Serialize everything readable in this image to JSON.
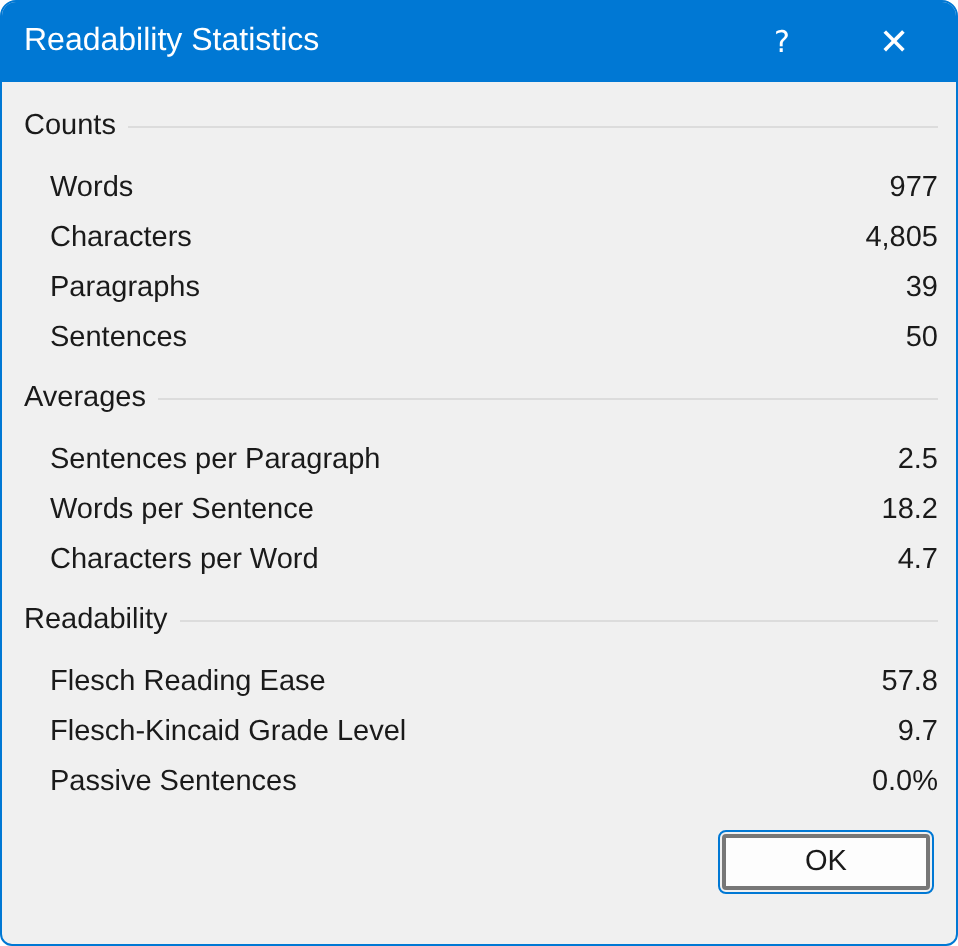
{
  "window": {
    "title": "Readability Statistics",
    "help": "?",
    "close": "✕"
  },
  "sections": [
    {
      "heading": "Counts",
      "rows": [
        {
          "label": "Words",
          "value": "977"
        },
        {
          "label": "Characters",
          "value": "4,805"
        },
        {
          "label": "Paragraphs",
          "value": "39"
        },
        {
          "label": "Sentences",
          "value": "50"
        }
      ]
    },
    {
      "heading": "Averages",
      "rows": [
        {
          "label": "Sentences per Paragraph",
          "value": "2.5"
        },
        {
          "label": "Words per Sentence",
          "value": "18.2"
        },
        {
          "label": "Characters per Word",
          "value": "4.7"
        }
      ]
    },
    {
      "heading": "Readability",
      "rows": [
        {
          "label": "Flesch Reading Ease",
          "value": "57.8"
        },
        {
          "label": "Flesch-Kincaid Grade Level",
          "value": "9.7"
        },
        {
          "label": "Passive Sentences",
          "value": "0.0%"
        }
      ]
    }
  ],
  "buttons": [
    "OK"
  ]
}
